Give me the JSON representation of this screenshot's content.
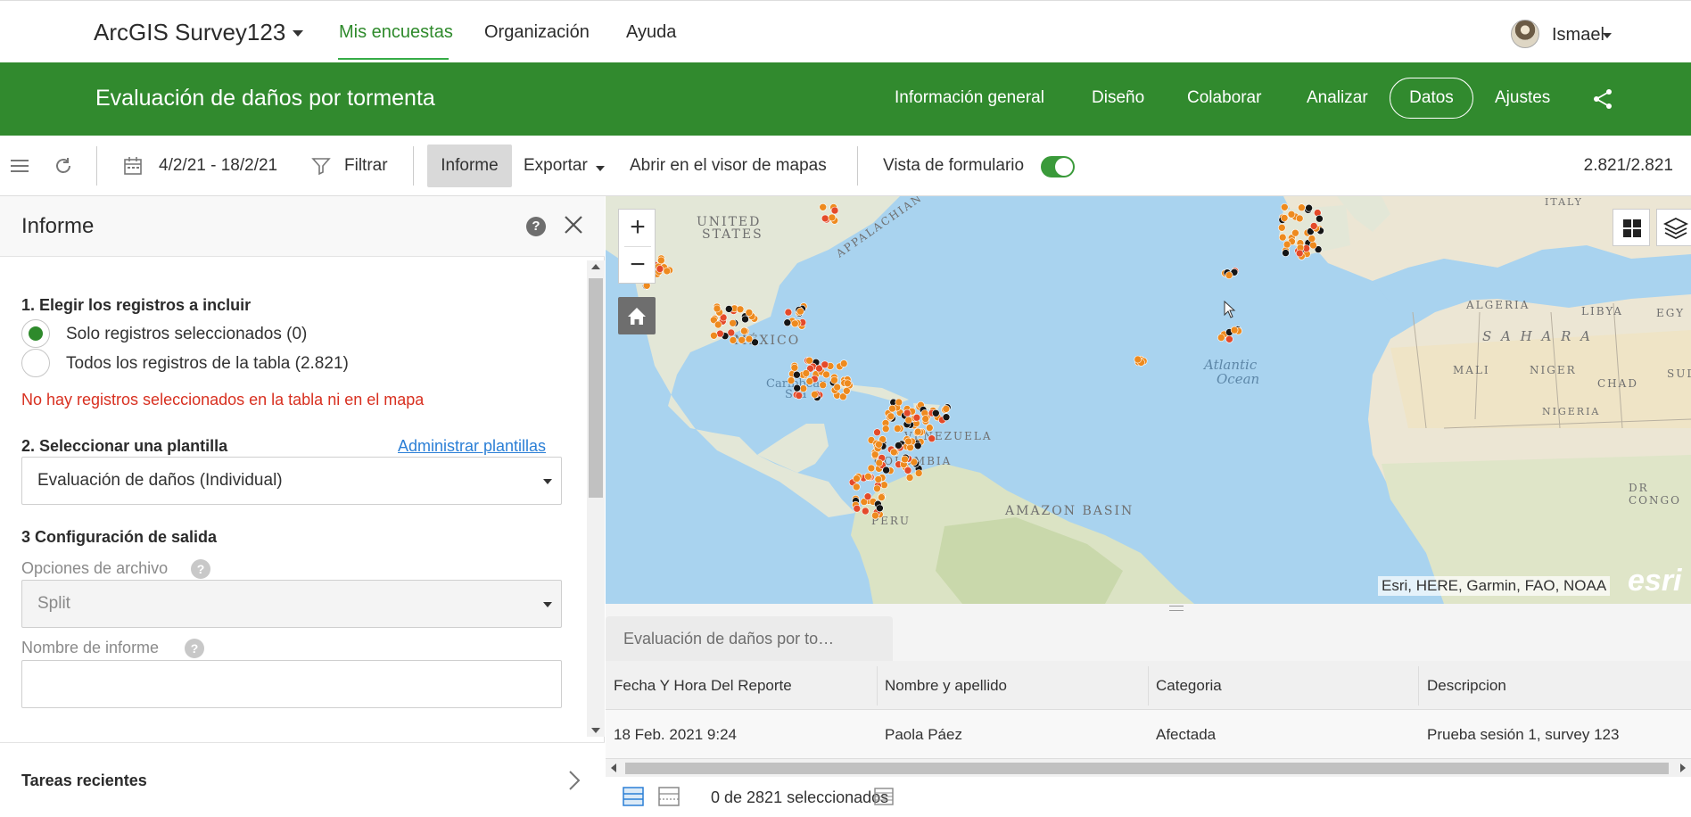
{
  "topnav": {
    "app_title": "ArcGIS Survey123",
    "links": [
      "Mis encuestas",
      "Organización",
      "Ayuda"
    ],
    "user_name": "Ismael"
  },
  "banner": {
    "survey_title": "Evaluación de daños por tormenta",
    "tabs": [
      "Información general",
      "Diseño",
      "Colaborar",
      "Analizar",
      "Datos",
      "Ajustes"
    ],
    "active_tab": "Datos",
    "accent_color": "#318a2e"
  },
  "toolbar": {
    "date_range": "4/2/21 - 18/2/21",
    "filter_label": "Filtrar",
    "report_label": "Informe",
    "export_label": "Exportar",
    "map_viewer_label": "Abrir en el visor de mapas",
    "form_view_label": "Vista de formulario",
    "form_view_on": true,
    "record_count": "2.821/2.821"
  },
  "report_panel": {
    "title": "Informe",
    "section1": "1. Elegir los registros a incluir",
    "option_selected": "Solo registros seleccionados (0)",
    "option_all": "Todos los registros de la tabla (2.821)",
    "error": "No hay registros seleccionados en la tabla ni en el mapa",
    "section2": "2. Seleccionar una plantilla",
    "manage_templates": "Administrar plantillas",
    "template_value": "Evaluación de daños (Individual)",
    "section3": "3 Configuración de salida",
    "file_options_label": "Opciones de archivo",
    "file_options_value": "Split",
    "report_name_label": "Nombre de informe",
    "recent_tasks": "Tareas recientes"
  },
  "map": {
    "labels": {
      "us": "UNITED",
      "us2": "STATES",
      "appalachian": "APPALACHIAN MTN",
      "mexico": "MÉXICO",
      "caribbean": "Caribbean",
      "sea": "Sea",
      "venezuela": "VENEZUELA",
      "colombia": "COLOMBIA",
      "peru": "PERU",
      "amazon": "AMAZON BASIN",
      "atlantic": "Atlantic",
      "ocean": "Ocean",
      "algeria": "ALGERIA",
      "libya": "LIBYA",
      "egypt": "EGY",
      "sahara": "S A H A R A",
      "mali": "MALI",
      "niger": "NIGER",
      "chad": "CHAD",
      "sudan": "SUD",
      "nigeria": "NIGERIA",
      "italy": "ITALY",
      "drc": "DR CONGO",
      "esri_logo": "esri"
    },
    "attribution": "Esri, HERE, Garmin, FAO, NOAA"
  },
  "table": {
    "tab_label": "Evaluación de daños por to…",
    "columns": [
      "Fecha Y Hora Del Reporte",
      "Nombre y apellido",
      "Categoria",
      "Descripcion"
    ],
    "rows": [
      [
        "18 Feb. 2021 9:24",
        "Paola Páez",
        "Afectada",
        "Prueba sesión 1, survey 123"
      ]
    ],
    "selection_status": "0 de 2821 seleccionados"
  }
}
